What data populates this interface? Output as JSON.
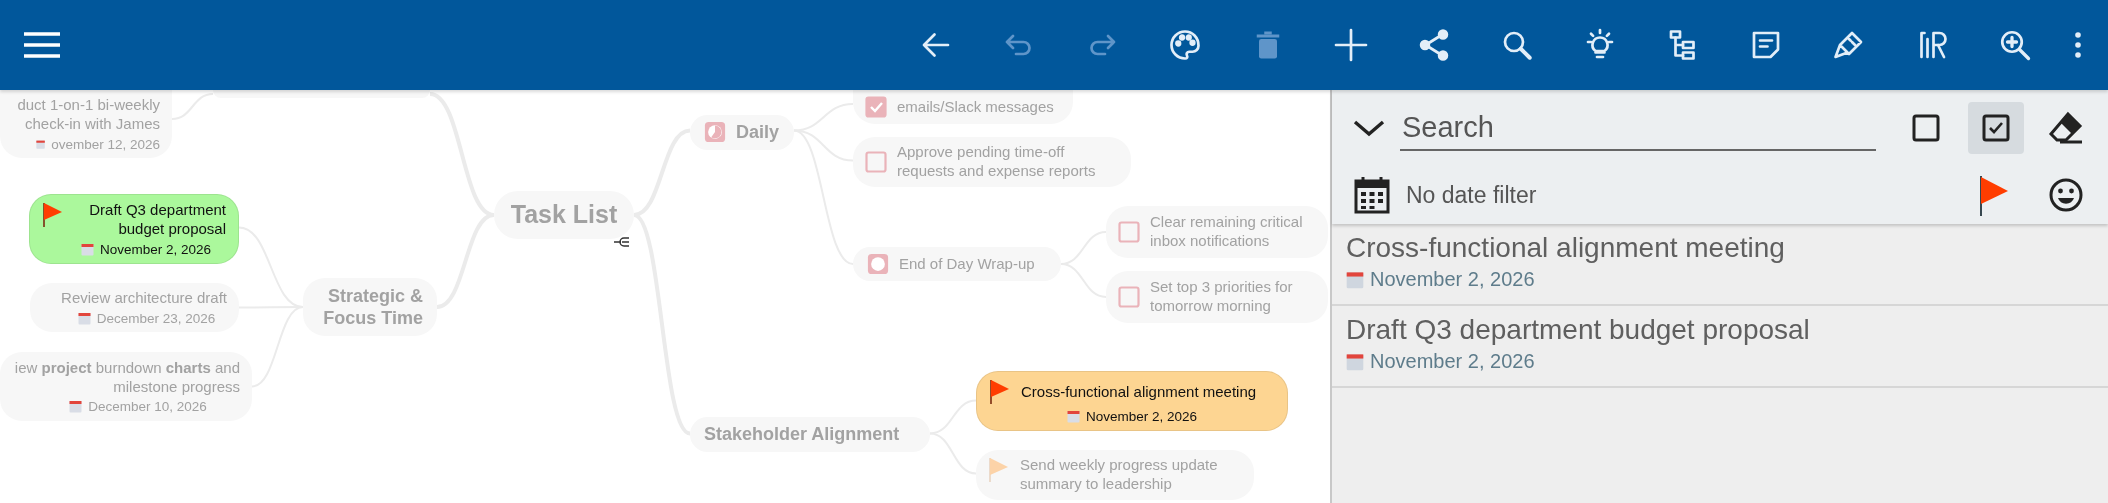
{
  "toolbar": {
    "menu": {
      "kind": "menu"
    },
    "buttons": [
      {
        "kind": "back",
        "disabled": false
      },
      {
        "kind": "undo",
        "disabled": true
      },
      {
        "kind": "redo",
        "disabled": true
      },
      {
        "kind": "palette",
        "disabled": false
      },
      {
        "kind": "delete",
        "disabled": true
      },
      {
        "kind": "add",
        "disabled": false
      },
      {
        "kind": "share",
        "disabled": false
      },
      {
        "kind": "search",
        "disabled": false
      },
      {
        "kind": "bulb",
        "disabled": false
      },
      {
        "kind": "tree",
        "disabled": false
      },
      {
        "kind": "note",
        "disabled": false
      },
      {
        "kind": "brush",
        "disabled": false
      },
      {
        "kind": "glyph",
        "disabled": false
      },
      {
        "kind": "zoom",
        "disabled": false
      },
      {
        "kind": "more",
        "disabled": false
      }
    ]
  },
  "mindmap": {
    "root": {
      "kind": "root",
      "text": "Task List",
      "dimmed": true,
      "children": [
        {
          "kind": "branch",
          "dimmed": true,
          "children": [
            {
              "kind": "task",
              "text": "duct 1-on-1 bi-weekly check-in with James",
              "date": "ovember 12, 2026",
              "dimmed": true
            }
          ]
        },
        {
          "kind": "branch",
          "text": "Strategic & Focus Time",
          "dimmed": true,
          "children": [
            {
              "kind": "task",
              "text": "Draft Q3 department budget proposal",
              "date": "November 2, 2026",
              "flag": true,
              "dimmed": false,
              "color": "#abf89c"
            },
            {
              "kind": "task",
              "text": "Review architecture draft",
              "date": "December 23, 2026",
              "dimmed": true
            },
            {
              "kind": "task",
              "text": "iew **project** burndown **charts** and milestone progress",
              "date": "December 10, 2026",
              "dimmed": true
            }
          ]
        },
        {
          "kind": "branch",
          "text": "Daily",
          "started": true,
          "dimmed": true,
          "children": [
            {
              "kind": "task",
              "text": "emails/Slack messages",
              "checked": true,
              "dimmed": true
            },
            {
              "kind": "task",
              "text": "Approve pending time-off requests and expense reports",
              "checked": false,
              "dimmed": true
            },
            {
              "kind": "group",
              "text": "End of Day Wrap-up",
              "started": false,
              "dimmed": true,
              "children": [
                {
                  "kind": "task",
                  "text": "Clear remaining critical inbox notifications",
                  "checked": false,
                  "dimmed": true
                },
                {
                  "kind": "task",
                  "text": "Set top 3 priorities for tomorrow morning",
                  "checked": false,
                  "dimmed": true
                }
              ]
            }
          ]
        },
        {
          "kind": "branch",
          "text": "Stakeholder Alignment",
          "dimmed": true,
          "children": [
            {
              "kind": "task",
              "text": "Cross-functional alignment meeting",
              "date": "November 2, 2026",
              "flag": true,
              "dimmed": false,
              "color": "#fdd592"
            },
            {
              "kind": "task",
              "text": "Send weekly progress update summary to leadership",
              "flag": true,
              "dimmed": true
            }
          ]
        }
      ]
    }
  },
  "filter_panel": {
    "search": {
      "placeholder": "Search"
    },
    "buttons": [
      {
        "kind": "unchecked",
        "selected": false
      },
      {
        "kind": "checked",
        "selected": true
      },
      {
        "kind": "eraser",
        "selected": false
      }
    ],
    "date_filter": "No date filter",
    "date_row_buttons": [
      {
        "kind": "flag"
      },
      {
        "kind": "smiley"
      }
    ],
    "results": [
      {
        "title": "Cross-functional alignment meeting",
        "date": "November 2, 2026"
      },
      {
        "title": "Draft Q3 department budget proposal",
        "date": "November 2, 2026"
      }
    ]
  }
}
